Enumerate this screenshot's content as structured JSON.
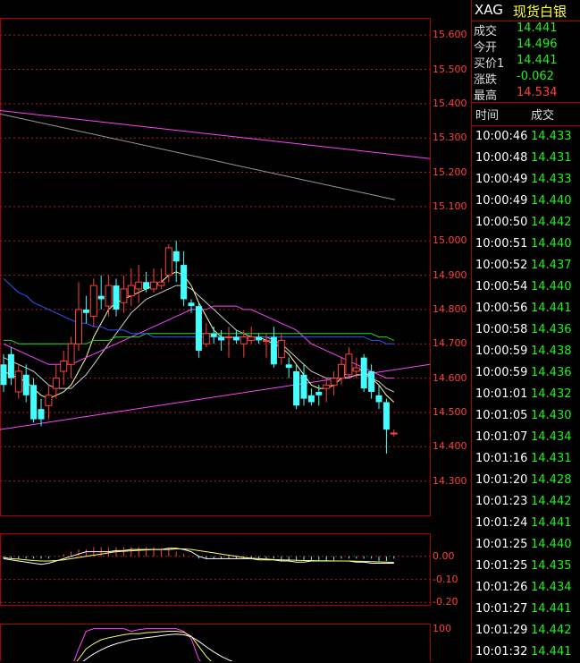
{
  "header": {
    "symbol": "XAG",
    "name": "现货白银"
  },
  "quote": [
    {
      "label": "成交",
      "value": "14.441",
      "color": "#22ee22"
    },
    {
      "label": "今开",
      "value": "14.496",
      "color": "#22ee22"
    },
    {
      "label": "买价1",
      "value": "14.441",
      "color": "#22ee22"
    },
    {
      "label": "涨跌",
      "value": "-0.062",
      "color": "#22ee22"
    },
    {
      "label": "最高",
      "value": "14.534",
      "color": "#ff4040"
    }
  ],
  "ticks_header": {
    "time": "时间",
    "price": "成交"
  },
  "ticks": [
    {
      "time": "10:00:46",
      "price": "14.433"
    },
    {
      "time": "10:00:48",
      "price": "14.431"
    },
    {
      "time": "10:00:49",
      "price": "14.433"
    },
    {
      "time": "10:00:49",
      "price": "14.440"
    },
    {
      "time": "10:00:50",
      "price": "14.442"
    },
    {
      "time": "10:00:51",
      "price": "14.440"
    },
    {
      "time": "10:00:52",
      "price": "14.437"
    },
    {
      "time": "10:00:54",
      "price": "14.440"
    },
    {
      "time": "10:00:56",
      "price": "14.441"
    },
    {
      "time": "10:00:58",
      "price": "14.436"
    },
    {
      "time": "10:00:59",
      "price": "14.438"
    },
    {
      "time": "10:00:59",
      "price": "14.436"
    },
    {
      "time": "10:01:01",
      "price": "14.432"
    },
    {
      "time": "10:01:05",
      "price": "14.430"
    },
    {
      "time": "10:01:07",
      "price": "14.434"
    },
    {
      "time": "10:01:16",
      "price": "14.431"
    },
    {
      "time": "10:01:20",
      "price": "14.428"
    },
    {
      "time": "10:01:23",
      "price": "14.442"
    },
    {
      "time": "10:01:24",
      "price": "14.441"
    },
    {
      "time": "10:01:25",
      "price": "14.440"
    },
    {
      "time": "10:01:25",
      "price": "14.435"
    },
    {
      "time": "10:01:26",
      "price": "14.434"
    },
    {
      "time": "10:01:27",
      "price": "14.441"
    },
    {
      "time": "10:01:29",
      "price": "14.442"
    },
    {
      "time": "10:01:32",
      "price": "14.441"
    }
  ],
  "chart_data": {
    "type": "candlestick",
    "price_axis": {
      "ticks": [
        "15.600",
        "15.500",
        "15.400",
        "15.300",
        "15.200",
        "15.100",
        "15.000",
        "14.900",
        "14.800",
        "14.700",
        "14.600",
        "14.500",
        "14.400",
        "14.300"
      ],
      "range": [
        14.2,
        15.65
      ]
    },
    "candles": [
      {
        "o": 14.64,
        "h": 14.67,
        "l": 14.56,
        "c": 14.58
      },
      {
        "o": 14.67,
        "h": 14.69,
        "l": 14.58,
        "c": 14.6
      },
      {
        "o": 14.56,
        "h": 14.64,
        "l": 14.54,
        "c": 14.62
      },
      {
        "o": 14.61,
        "h": 14.64,
        "l": 14.53,
        "c": 14.55
      },
      {
        "o": 14.58,
        "h": 14.6,
        "l": 14.47,
        "c": 14.48
      },
      {
        "o": 14.51,
        "h": 14.54,
        "l": 14.46,
        "c": 14.48
      },
      {
        "o": 14.52,
        "h": 14.58,
        "l": 14.48,
        "c": 14.55
      },
      {
        "o": 14.57,
        "h": 14.64,
        "l": 14.54,
        "c": 14.6
      },
      {
        "o": 14.62,
        "h": 14.68,
        "l": 14.58,
        "c": 14.65
      },
      {
        "o": 14.64,
        "h": 14.72,
        "l": 14.6,
        "c": 14.7
      },
      {
        "o": 14.7,
        "h": 14.88,
        "l": 14.68,
        "c": 14.8
      },
      {
        "o": 14.8,
        "h": 14.84,
        "l": 14.76,
        "c": 14.79
      },
      {
        "o": 14.78,
        "h": 14.89,
        "l": 14.75,
        "c": 14.87
      },
      {
        "o": 14.84,
        "h": 14.9,
        "l": 14.8,
        "c": 14.83
      },
      {
        "o": 14.81,
        "h": 14.9,
        "l": 14.78,
        "c": 14.87
      },
      {
        "o": 14.87,
        "h": 14.89,
        "l": 14.78,
        "c": 14.8
      },
      {
        "o": 14.82,
        "h": 14.9,
        "l": 14.79,
        "c": 14.86
      },
      {
        "o": 14.84,
        "h": 14.92,
        "l": 14.81,
        "c": 14.87
      },
      {
        "o": 14.86,
        "h": 14.93,
        "l": 14.82,
        "c": 14.88
      },
      {
        "o": 14.88,
        "h": 14.91,
        "l": 14.85,
        "c": 14.86
      },
      {
        "o": 14.86,
        "h": 14.92,
        "l": 14.85,
        "c": 14.88
      },
      {
        "o": 14.87,
        "h": 14.92,
        "l": 14.86,
        "c": 14.88
      },
      {
        "o": 14.9,
        "h": 14.99,
        "l": 14.88,
        "c": 14.98
      },
      {
        "o": 14.97,
        "h": 15.0,
        "l": 14.88,
        "c": 14.94
      },
      {
        "o": 14.93,
        "h": 14.97,
        "l": 14.81,
        "c": 14.83
      },
      {
        "o": 14.82,
        "h": 14.83,
        "l": 14.79,
        "c": 14.81
      },
      {
        "o": 14.81,
        "h": 14.82,
        "l": 14.66,
        "c": 14.68
      },
      {
        "o": 14.7,
        "h": 14.76,
        "l": 14.69,
        "c": 14.73
      },
      {
        "o": 14.73,
        "h": 14.75,
        "l": 14.7,
        "c": 14.72
      },
      {
        "o": 14.72,
        "h": 14.74,
        "l": 14.68,
        "c": 14.71
      },
      {
        "o": 14.72,
        "h": 14.75,
        "l": 14.66,
        "c": 14.72
      },
      {
        "o": 14.72,
        "h": 14.74,
        "l": 14.7,
        "c": 14.71
      },
      {
        "o": 14.7,
        "h": 14.74,
        "l": 14.66,
        "c": 14.72
      },
      {
        "o": 14.71,
        "h": 14.75,
        "l": 14.7,
        "c": 14.72
      },
      {
        "o": 14.72,
        "h": 14.73,
        "l": 14.7,
        "c": 14.71
      },
      {
        "o": 14.71,
        "h": 14.73,
        "l": 14.66,
        "c": 14.71
      },
      {
        "o": 14.72,
        "h": 14.75,
        "l": 14.63,
        "c": 14.64
      },
      {
        "o": 14.66,
        "h": 14.73,
        "l": 14.64,
        "c": 14.71
      },
      {
        "o": 14.64,
        "h": 14.66,
        "l": 14.6,
        "c": 14.63
      },
      {
        "o": 14.62,
        "h": 14.64,
        "l": 14.51,
        "c": 14.52
      },
      {
        "o": 14.61,
        "h": 14.64,
        "l": 14.52,
        "c": 14.54
      },
      {
        "o": 14.55,
        "h": 14.57,
        "l": 14.52,
        "c": 14.53
      },
      {
        "o": 14.56,
        "h": 14.58,
        "l": 14.52,
        "c": 14.55
      },
      {
        "o": 14.57,
        "h": 14.6,
        "l": 14.53,
        "c": 14.58
      },
      {
        "o": 14.58,
        "h": 14.62,
        "l": 14.55,
        "c": 14.6
      },
      {
        "o": 14.6,
        "h": 14.66,
        "l": 14.58,
        "c": 14.64
      },
      {
        "o": 14.61,
        "h": 14.69,
        "l": 14.6,
        "c": 14.67
      },
      {
        "o": 14.62,
        "h": 14.66,
        "l": 14.6,
        "c": 14.63
      },
      {
        "o": 14.66,
        "h": 14.67,
        "l": 14.56,
        "c": 14.57
      },
      {
        "o": 14.62,
        "h": 14.64,
        "l": 14.54,
        "c": 14.56
      },
      {
        "o": 14.55,
        "h": 14.58,
        "l": 14.51,
        "c": 14.53
      },
      {
        "o": 14.53,
        "h": 14.54,
        "l": 14.38,
        "c": 14.45
      },
      {
        "o": 14.44,
        "h": 14.45,
        "l": 14.43,
        "c": 14.44
      }
    ],
    "ma_lines": [
      {
        "color": "#ffffa0",
        "values": [
          14.62,
          14.61,
          14.6,
          14.59,
          14.57,
          14.55,
          14.54,
          14.55,
          14.56,
          14.58,
          14.62,
          14.66,
          14.72,
          14.76,
          14.8,
          14.82,
          14.83,
          14.84,
          14.85,
          14.86,
          14.87,
          14.88,
          14.9,
          14.91,
          14.9,
          14.87,
          14.82,
          14.78,
          14.74,
          14.72,
          14.72,
          14.72,
          14.72,
          14.72,
          14.72,
          14.71,
          14.7,
          14.69,
          14.67,
          14.64,
          14.61,
          14.58,
          14.57,
          14.57,
          14.58,
          14.6,
          14.62,
          14.63,
          14.62,
          14.6,
          14.58,
          14.55,
          14.53
        ]
      },
      {
        "color": "#cccccc",
        "values": [
          14.66,
          14.65,
          14.64,
          14.63,
          14.62,
          14.6,
          14.58,
          14.57,
          14.57,
          14.57,
          14.59,
          14.61,
          14.64,
          14.67,
          14.7,
          14.73,
          14.76,
          14.79,
          14.81,
          14.83,
          14.84,
          14.85,
          14.86,
          14.87,
          14.87,
          14.86,
          14.84,
          14.82,
          14.8,
          14.78,
          14.76,
          14.74,
          14.73,
          14.72,
          14.72,
          14.72,
          14.71,
          14.7,
          14.68,
          14.66,
          14.64,
          14.62,
          14.61,
          14.6,
          14.6,
          14.6,
          14.6,
          14.61,
          14.61,
          14.6,
          14.59,
          14.57,
          14.56
        ]
      },
      {
        "color": "#ff44ff",
        "values": [
          14.7,
          14.69,
          14.68,
          14.67,
          14.66,
          14.65,
          14.64,
          14.64,
          14.64,
          14.64,
          14.65,
          14.66,
          14.67,
          14.68,
          14.69,
          14.7,
          14.71,
          14.72,
          14.73,
          14.74,
          14.75,
          14.76,
          14.77,
          14.78,
          14.79,
          14.8,
          14.8,
          14.8,
          14.81,
          14.81,
          14.81,
          14.81,
          14.8,
          14.8,
          14.79,
          14.78,
          14.77,
          14.76,
          14.75,
          14.74,
          14.72,
          14.7,
          14.69,
          14.68,
          14.67,
          14.66,
          14.65,
          14.64,
          14.63,
          14.62,
          14.61,
          14.6,
          14.6
        ]
      },
      {
        "color": "#22dd22",
        "values": [
          14.71,
          14.71,
          14.7,
          14.7,
          14.7,
          14.7,
          14.7,
          14.7,
          14.7,
          14.7,
          14.7,
          14.7,
          14.71,
          14.71,
          14.71,
          14.72,
          14.72,
          14.72,
          14.72,
          14.73,
          14.73,
          14.73,
          14.73,
          14.73,
          14.73,
          14.73,
          14.73,
          14.73,
          14.73,
          14.73,
          14.73,
          14.73,
          14.73,
          14.73,
          14.73,
          14.73,
          14.73,
          14.73,
          14.73,
          14.73,
          14.73,
          14.73,
          14.73,
          14.73,
          14.73,
          14.73,
          14.73,
          14.73,
          14.73,
          14.73,
          14.72,
          14.72,
          14.71
        ]
      },
      {
        "color": "#3355ff",
        "values": [
          14.89,
          14.87,
          14.85,
          14.84,
          14.82,
          14.81,
          14.8,
          14.79,
          14.78,
          14.77,
          14.76,
          14.76,
          14.75,
          14.75,
          14.74,
          14.74,
          14.74,
          14.73,
          14.73,
          14.73,
          14.72,
          14.72,
          14.72,
          14.72,
          14.72,
          14.72,
          14.72,
          14.72,
          14.72,
          14.72,
          14.72,
          14.72,
          14.72,
          14.72,
          14.72,
          14.72,
          14.72,
          14.72,
          14.72,
          14.72,
          14.72,
          14.72,
          14.72,
          14.72,
          14.72,
          14.72,
          14.72,
          14.72,
          14.72,
          14.71,
          14.71,
          14.7,
          14.7
        ]
      }
    ],
    "macd_axis": {
      "ticks": [
        "0.00",
        "-0.10",
        "-0.20"
      ],
      "range": [
        -0.21,
        0.1
      ]
    },
    "macd_hist": [
      -0.01,
      -0.01,
      -0.01,
      -0.01,
      -0.01,
      -0.01,
      -0.01,
      0.0,
      0.01,
      0.02,
      0.03,
      0.03,
      0.04,
      0.04,
      0.04,
      0.04,
      0.04,
      0.04,
      0.04,
      0.04,
      0.04,
      0.03,
      0.03,
      0.02,
      0.01,
      0.0,
      -0.01,
      -0.01,
      -0.01,
      -0.01,
      -0.01,
      -0.01,
      -0.01,
      -0.01,
      -0.01,
      -0.01,
      -0.01,
      -0.02,
      -0.02,
      -0.02,
      -0.02,
      -0.02,
      -0.02,
      -0.02,
      -0.02,
      -0.01,
      -0.01,
      -0.01,
      -0.01,
      -0.01,
      -0.02,
      -0.02,
      -0.01
    ],
    "macd_dif": [
      -0.01,
      -0.015,
      -0.02,
      -0.025,
      -0.03,
      -0.035,
      -0.03,
      -0.02,
      -0.01,
      0.0,
      0.01,
      0.02,
      0.02,
      0.02,
      0.02,
      0.025,
      0.025,
      0.03,
      0.03,
      0.03,
      0.03,
      0.03,
      0.035,
      0.035,
      0.03,
      0.02,
      0.0,
      -0.01,
      -0.01,
      -0.01,
      -0.01,
      -0.01,
      -0.01,
      -0.01,
      -0.015,
      -0.015,
      -0.015,
      -0.02,
      -0.02,
      -0.025,
      -0.025,
      -0.02,
      -0.02,
      -0.02,
      -0.02,
      -0.02,
      -0.02,
      -0.025,
      -0.025,
      -0.03,
      -0.03,
      -0.03,
      -0.03
    ],
    "macd_dea": [
      -0.005,
      -0.01,
      -0.012,
      -0.015,
      -0.018,
      -0.02,
      -0.02,
      -0.018,
      -0.015,
      -0.01,
      -0.005,
      0.0,
      0.005,
      0.01,
      0.015,
      0.02,
      0.022,
      0.024,
      0.026,
      0.028,
      0.03,
      0.03,
      0.03,
      0.032,
      0.032,
      0.03,
      0.025,
      0.02,
      0.015,
      0.01,
      0.005,
      0.0,
      -0.005,
      -0.008,
      -0.01,
      -0.012,
      -0.014,
      -0.015,
      -0.016,
      -0.017,
      -0.018,
      -0.018,
      -0.019,
      -0.019,
      -0.02,
      -0.02,
      -0.02,
      -0.021,
      -0.022,
      -0.023,
      -0.024,
      -0.025,
      -0.026
    ],
    "kdj_axis": {
      "ticks": [
        "100"
      ],
      "range": [
        0,
        110
      ]
    },
    "kdj_lines": [
      {
        "color": "#ff44ff",
        "values": [
          5,
          5,
          5,
          5,
          5,
          5,
          5,
          5,
          5,
          20,
          60,
          95,
          100,
          100,
          100,
          100,
          100,
          95,
          98,
          100,
          100,
          100,
          100,
          100,
          95,
          80,
          40,
          20,
          10,
          5,
          5,
          5,
          5,
          5,
          5,
          5,
          5,
          5,
          5,
          5,
          5,
          5,
          5,
          5,
          10,
          20,
          25,
          15,
          10,
          5,
          5,
          5,
          5
        ]
      },
      {
        "color": "#ffff66",
        "values": [
          10,
          10,
          10,
          10,
          10,
          10,
          10,
          10,
          12,
          20,
          40,
          60,
          70,
          78,
          82,
          85,
          88,
          90,
          90,
          92,
          93,
          94,
          95,
          95,
          93,
          85,
          65,
          45,
          30,
          20,
          15,
          12,
          10,
          10,
          10,
          10,
          10,
          10,
          10,
          10,
          10,
          10,
          10,
          10,
          12,
          15,
          18,
          16,
          14,
          12,
          10,
          10,
          10
        ]
      },
      {
        "color": "#ffffff",
        "values": [
          12,
          12,
          12,
          12,
          12,
          12,
          12,
          12,
          13,
          17,
          28,
          40,
          50,
          58,
          65,
          70,
          74,
          78,
          80,
          82,
          84,
          86,
          88,
          89,
          88,
          84,
          75,
          64,
          54,
          45,
          38,
          32,
          27,
          24,
          21,
          19,
          17,
          16,
          15,
          14,
          13,
          13,
          12,
          12,
          13,
          14,
          15,
          15,
          15,
          14,
          13,
          13,
          12
        ]
      }
    ]
  }
}
